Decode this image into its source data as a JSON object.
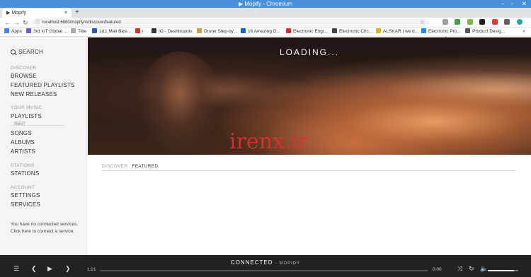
{
  "window": {
    "title": "▶ Mopify - Chromium"
  },
  "tabs": [
    {
      "label": "▶ Mopify"
    }
  ],
  "address": {
    "url": "localhost:6680/mopify/#/discover/featured"
  },
  "bookmarks": [
    {
      "label": "Apps",
      "color": "#4285f4"
    },
    {
      "label": "3rd IoT Global ...",
      "color": "#6b5bd0"
    },
    {
      "label": "Title",
      "color": "#aaaaaa"
    },
    {
      "label": "1&1 Mail Basi...",
      "color": "#2458a8"
    },
    {
      "label": "r",
      "color": "#d93025"
    },
    {
      "label": "IO - Dashboards",
      "color": "#333333"
    },
    {
      "label": "Drone Step-by...",
      "color": "#c8a24a"
    },
    {
      "label": "16 Amazing D...",
      "color": "#1565c0"
    },
    {
      "label": "Electronic Engi...",
      "color": "#d32f2f"
    },
    {
      "label": "Electronic Circ...",
      "color": "#444444"
    },
    {
      "label": "ALSKAR | we d...",
      "color": "#e0b020"
    },
    {
      "label": "Electronic Pro...",
      "color": "#1e88e5"
    },
    {
      "label": "Product Desig...",
      "color": "#555555"
    }
  ],
  "sidebar": {
    "search_label": "SEARCH",
    "sections": {
      "discover": "DISCOVER",
      "your_music": "YOUR MUSIC",
      "stations": "STATIONS",
      "account": "ACCOUNT"
    },
    "items": {
      "browse": "BROWSE",
      "featured_playlists": "FEATURED PLAYLISTS",
      "new_releases": "NEW RELEASES",
      "playlists": "PLAYLISTS",
      "playlist_sub": "REST",
      "songs": "SONGS",
      "albums": "ALBUMS",
      "artists": "ARTISTS",
      "stations": "STATIONS",
      "settings": "SETTINGS",
      "services": "SERVICES"
    },
    "note": "You have no connected services. Click here to connect a service."
  },
  "main": {
    "loading": "LOADING...",
    "watermark": "irenx.ir",
    "breadcrumb": {
      "parent": "DISCOVER",
      "current": "FEATURED"
    }
  },
  "player": {
    "status": "CONNECTED",
    "status_sub": "- MOPIDY",
    "elapsed": "1:21",
    "duration": "0:00",
    "progress": 0.0,
    "volume": 0.85
  }
}
